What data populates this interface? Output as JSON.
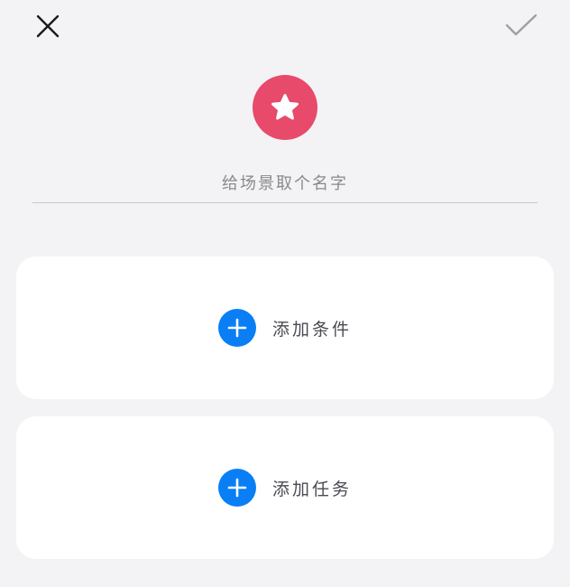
{
  "header": {
    "close_icon": "close-icon",
    "confirm_icon": "checkmark-icon"
  },
  "scene": {
    "icon": "star-icon",
    "icon_color": "#e74a6b",
    "name_placeholder": "给场景取个名字",
    "name_value": ""
  },
  "conditions_card": {
    "add_label": "添加条件",
    "icon": "plus-icon"
  },
  "tasks_card": {
    "add_label": "添加任务",
    "icon": "plus-icon"
  },
  "colors": {
    "background": "#f3f3f5",
    "card": "#ffffff",
    "accent": "#0a7ef5",
    "scene_icon": "#e74a6b",
    "confirm_disabled": "#a0a0a4"
  }
}
